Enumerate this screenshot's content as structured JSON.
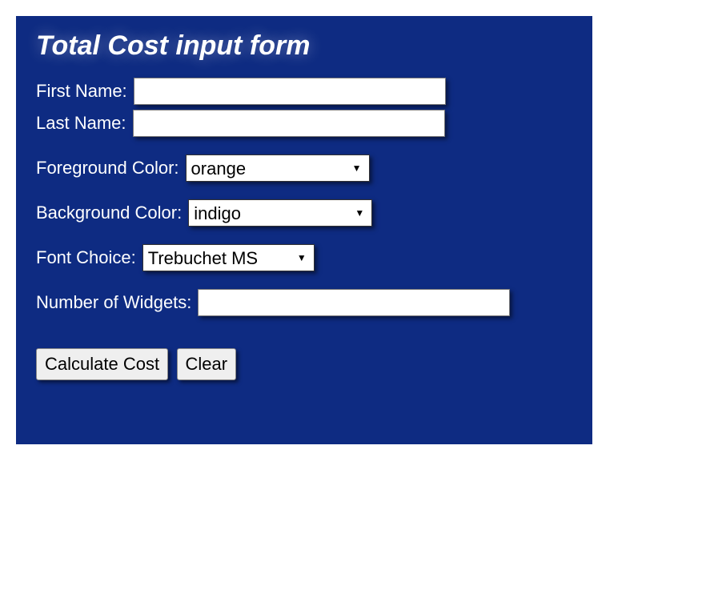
{
  "title": "Total Cost input form",
  "fields": {
    "firstName": {
      "label": "First Name:",
      "value": ""
    },
    "lastName": {
      "label": "Last Name:",
      "value": ""
    },
    "fgColor": {
      "label": "Foreground Color:",
      "value": "orange"
    },
    "bgColor": {
      "label": "Background Color:",
      "value": "indigo"
    },
    "font": {
      "label": "Font Choice:",
      "value": "Trebuchet MS"
    },
    "widgets": {
      "label": "Number of Widgets:",
      "value": ""
    }
  },
  "buttons": {
    "calculate": "Calculate Cost",
    "clear": "Clear"
  }
}
